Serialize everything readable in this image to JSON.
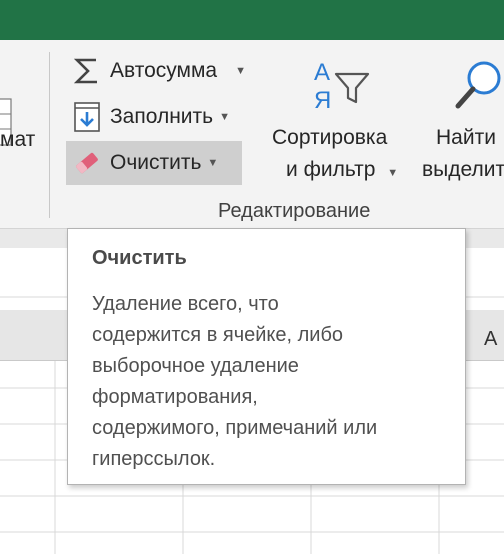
{
  "ribbon": {
    "format_partial_label": "мат",
    "editing": {
      "autosum_label": "Автосумма",
      "fill_label": "Заполнить",
      "clear_label": "Очистить",
      "sort_line1": "Сортировка",
      "sort_line2": "и фильтр",
      "find_line1": "Найти",
      "find_line2": "выделить",
      "group_label": "Редактирование"
    }
  },
  "sheet": {
    "column_header_partial": "А"
  },
  "tooltip": {
    "title": "Очистить",
    "description": "Удаление всего, что\nсодержится в ячейке, либо\nвыборочное удаление\nформатирования,\nсодержимого, примечаний или\nгиперссылок."
  },
  "colors": {
    "title_bar": "#217346",
    "ribbon_bg": "#f3f3f3",
    "pressed_button": "#cfcfcf",
    "accent_blue": "#2b7cd3",
    "eraser_pink": "#e0607a"
  },
  "icons": [
    "sigma-icon",
    "fill-down-icon",
    "eraser-icon",
    "sort-filter-icon",
    "magnifier-icon",
    "grid-icon",
    "chevron-down-icon"
  ]
}
